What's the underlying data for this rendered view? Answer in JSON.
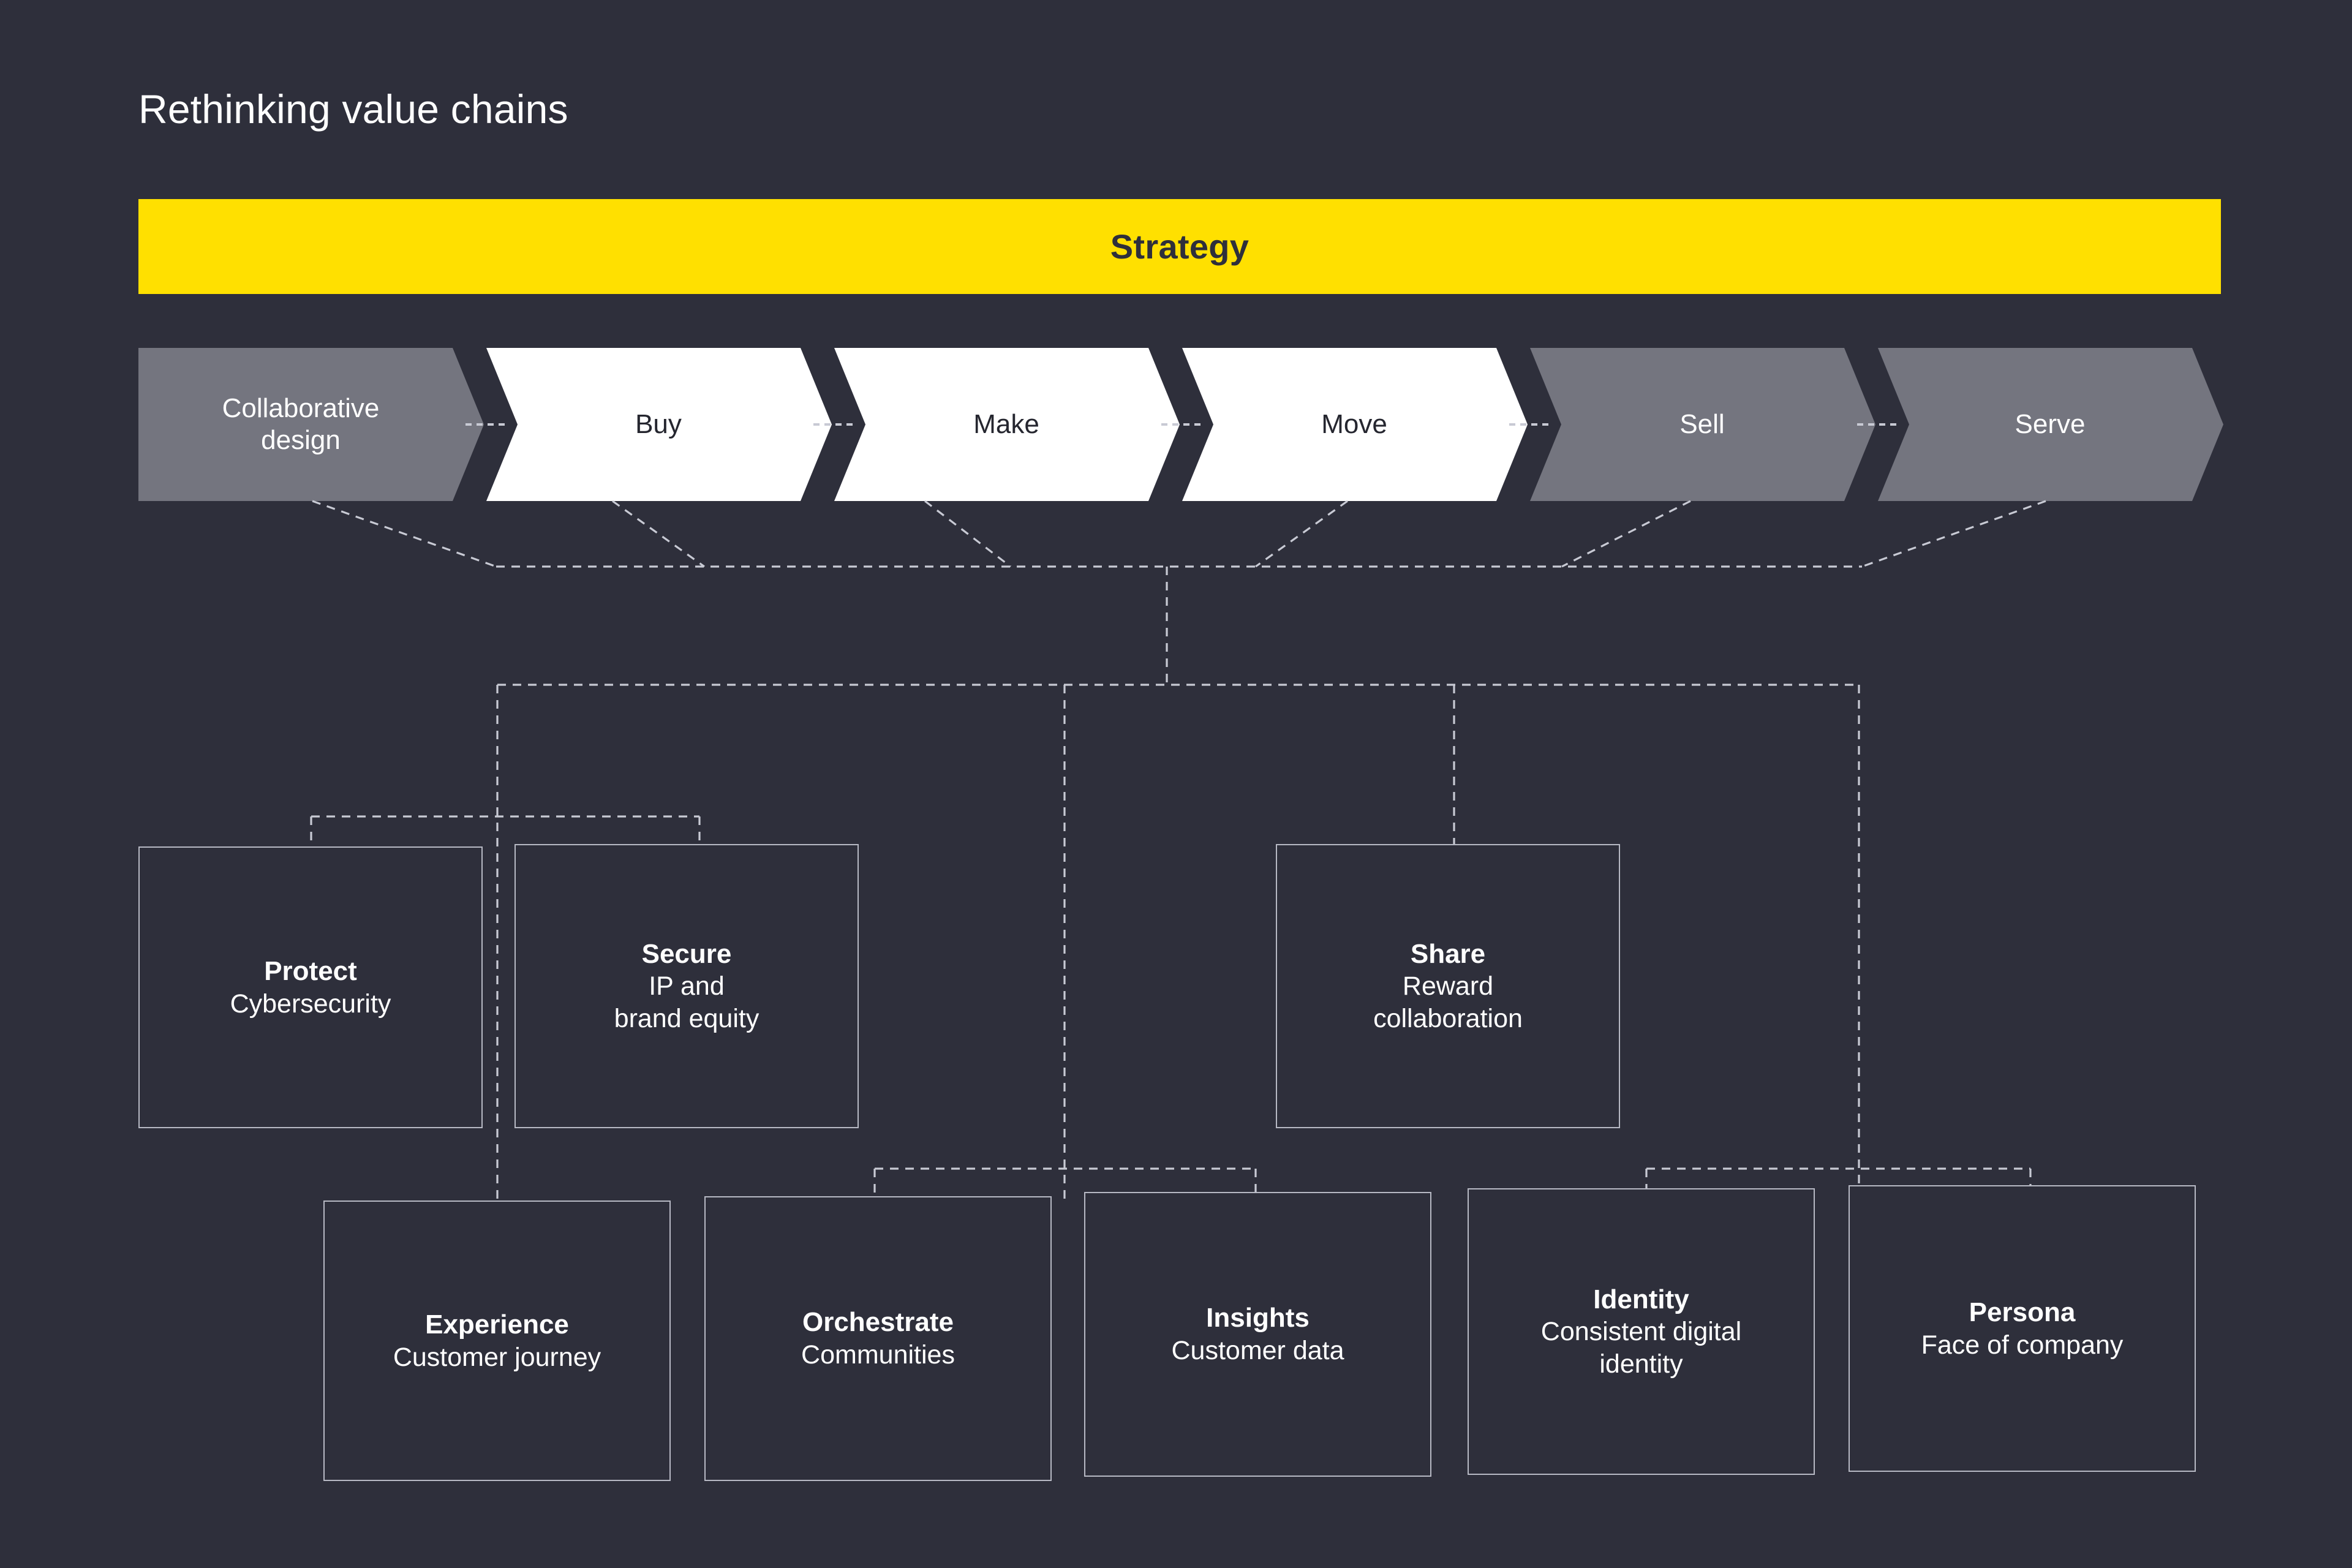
{
  "page": {
    "title": "Rethinking value chains",
    "background_color": "#2E2F3B"
  },
  "colors": {
    "background": "#2E2F3B",
    "strategy_yellow": "#FFE000",
    "chevron_gray": "#74757F",
    "chevron_white": "#FFFFFF",
    "connector_line": "#C8CAD4",
    "box_border": "#B7B9C4",
    "text_light": "#FFFFFF",
    "text_dark": "#25262F"
  },
  "strategy": {
    "label": "Strategy"
  },
  "value_chain": {
    "stages": [
      {
        "label": "Collaborative\ndesign",
        "fill": "gray",
        "text": "light"
      },
      {
        "label": "Buy",
        "fill": "white",
        "text": "dark"
      },
      {
        "label": "Make",
        "fill": "white",
        "text": "dark"
      },
      {
        "label": "Move",
        "fill": "white",
        "text": "dark"
      },
      {
        "label": "Sell",
        "fill": "gray",
        "text": "light"
      },
      {
        "label": "Serve",
        "fill": "gray",
        "text": "light"
      }
    ]
  },
  "capability_row_1": [
    {
      "title": "Protect",
      "subtitle": "Cybersecurity"
    },
    {
      "title": "Secure",
      "subtitle": "IP and\nbrand equity"
    },
    {
      "title": "Share",
      "subtitle": "Reward\ncollaboration"
    }
  ],
  "capability_row_2": [
    {
      "title": "Experience",
      "subtitle": "Customer journey"
    },
    {
      "title": "Orchestrate",
      "subtitle": "Communities"
    },
    {
      "title": "Insights",
      "subtitle": "Customer data"
    },
    {
      "title": "Identity",
      "subtitle": "Consistent digital\nidentity"
    },
    {
      "title": "Persona",
      "subtitle": "Face of company"
    }
  ]
}
